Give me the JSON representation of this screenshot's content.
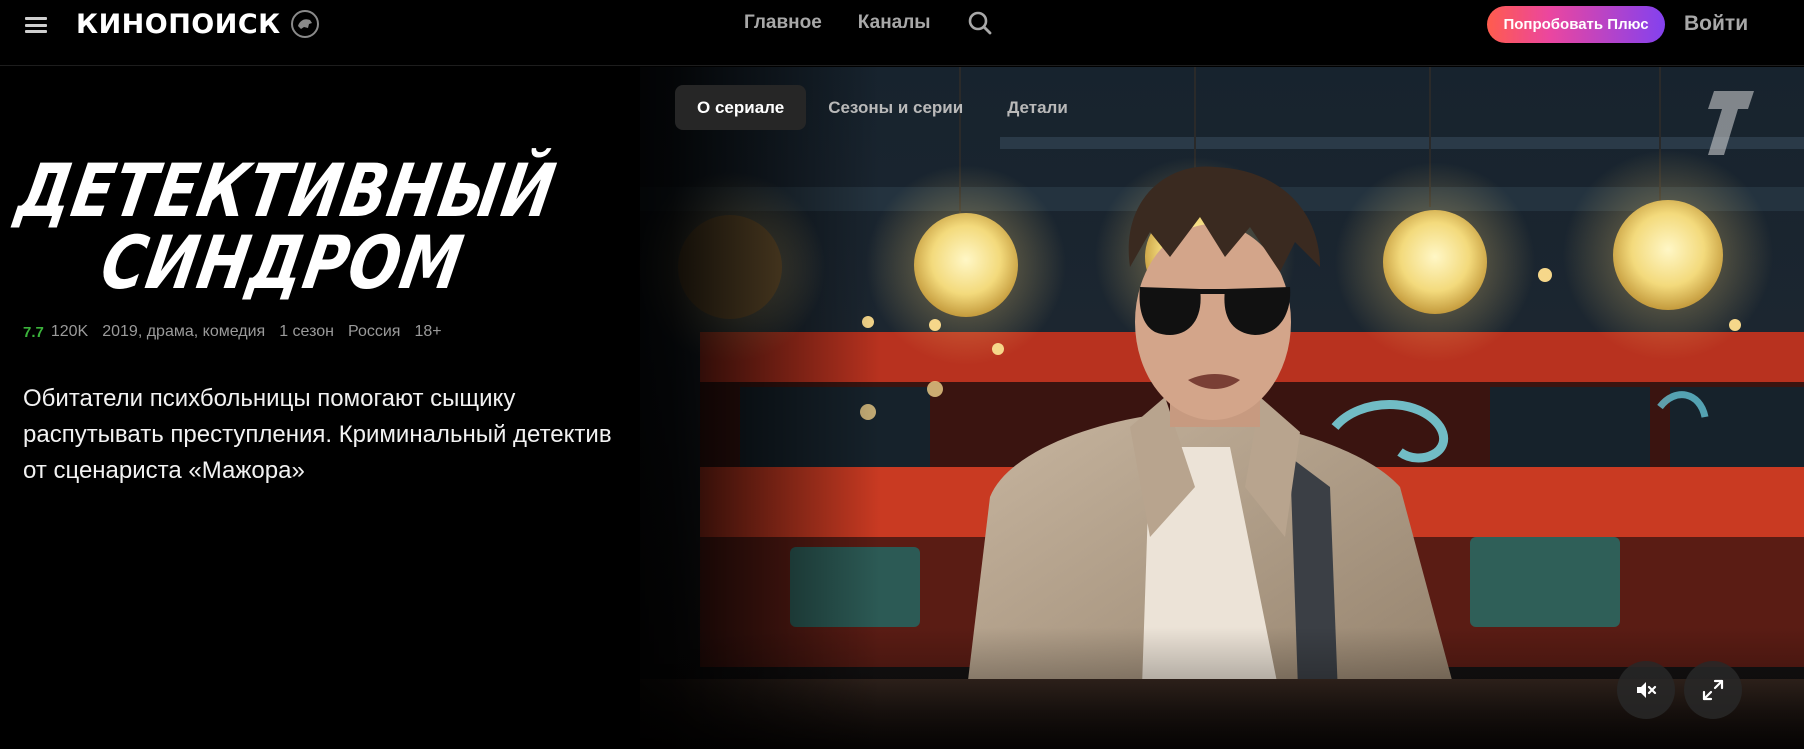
{
  "header": {
    "logo_text": "КИНОПОИСК",
    "nav": [
      {
        "label": "Главное"
      },
      {
        "label": "Каналы"
      }
    ],
    "plus_label": "Попробовать Плюс",
    "login_label": "Войти"
  },
  "tabs": [
    {
      "label": "О сериале",
      "active": true
    },
    {
      "label": "Сезоны и серии",
      "active": false
    },
    {
      "label": "Детали",
      "active": false
    }
  ],
  "title": {
    "line1": "ДЕТЕКТИВНЫЙ",
    "line2": "СИНДРОМ"
  },
  "meta": {
    "rating": "7.7",
    "votes": "120K",
    "info": "2019, драма, комедия",
    "seasons": "1 сезон",
    "country": "Россия",
    "age": "18+"
  },
  "description": "Обитатели психбольницы помогают сыщику распутывать преступления. Криминальный детектив от сценариста «Мажора»",
  "icons": {
    "menu": "hamburger-icon",
    "search": "search-icon",
    "mute": "mute-icon",
    "fullscreen": "fullscreen-icon",
    "channel": "channel-one-logo"
  },
  "colors": {
    "rating": "#3bb33b",
    "plus_gradient_start": "#ff5c4d",
    "plus_gradient_end": "#8341ef",
    "background": "#000000"
  }
}
